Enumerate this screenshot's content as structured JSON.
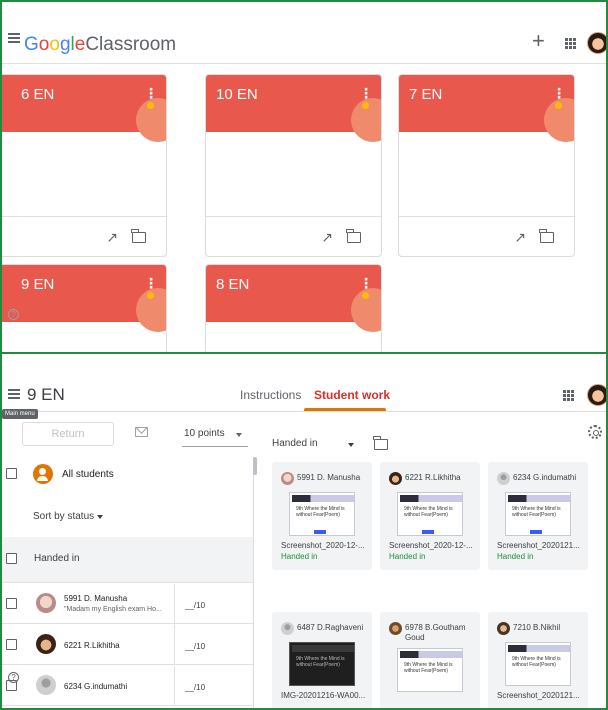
{
  "classroom": {
    "app_name_google": "Google",
    "app_name_product": "Classroom",
    "icons": [
      "menu-icon",
      "plus-icon",
      "apps-icon",
      "avatar"
    ],
    "classes": [
      {
        "name": "6 EN"
      },
      {
        "name": "10 EN"
      },
      {
        "name": "7 EN"
      },
      {
        "name": "9 EN"
      },
      {
        "name": "8 EN"
      }
    ],
    "help_glyph": "?"
  },
  "student_work": {
    "class_name": "9 EN",
    "tabs": [
      {
        "label": "Instructions",
        "active": false
      },
      {
        "label": "Student work",
        "active": true
      }
    ],
    "tooltip": "Main menu",
    "toolbar": {
      "return_label": "Return",
      "points": "10 points"
    },
    "list": {
      "all_students": "All students",
      "sort": "Sort by status",
      "section": "Handed in",
      "rows": [
        {
          "name": "5991 D. Manusha",
          "comment": "\"Madam my English exam Ho...",
          "grade": "__/10"
        },
        {
          "name": "6221 R.Likhitha",
          "comment": "",
          "grade": "__/10"
        },
        {
          "name": "6234 G.indumathi",
          "comment": "",
          "grade": "__/10"
        }
      ]
    },
    "filter": "Handed in",
    "submissions": [
      {
        "name": "5991 D. Manusha",
        "file": "Screenshot_2020-12-...",
        "status": "Handed in",
        "thumb_text": "9th Where the Mind is without Fear(Poem)"
      },
      {
        "name": "6221 R.Likhitha",
        "file": "Screenshot_2020-12-...",
        "status": "Handed in",
        "thumb_text": "9th Where the Mind is without Fear(Poem)"
      },
      {
        "name": "6234 G.indumathi",
        "file": "Screenshot_2020121...",
        "status": "Handed in",
        "thumb_text": "9th Where the Mind is without Fear(Poem)"
      },
      {
        "name": "6487 D.Raghaveni",
        "file": "IMG-20201216-WA00...",
        "status": "",
        "thumb_text": "9th Where the Mind is without Fear(Poem)"
      },
      {
        "name": "6978 B.Goutham Goud",
        "file": "",
        "status": "",
        "thumb_text": "9th Where the Mind is without Fear(Poem)"
      },
      {
        "name": "7210 B.Nikhil",
        "file": "Screenshot_2020121...",
        "status": "",
        "thumb_text": "9th Where the Mind is without Fear(Poem)"
      }
    ],
    "help_glyph": "?"
  },
  "colors": {
    "card_banner": "#e8584c",
    "accent_tab": "#e37400",
    "active_tab_text": "#d93025",
    "handed_in": "#1e8e3e",
    "frame": "#1e8e3e"
  }
}
